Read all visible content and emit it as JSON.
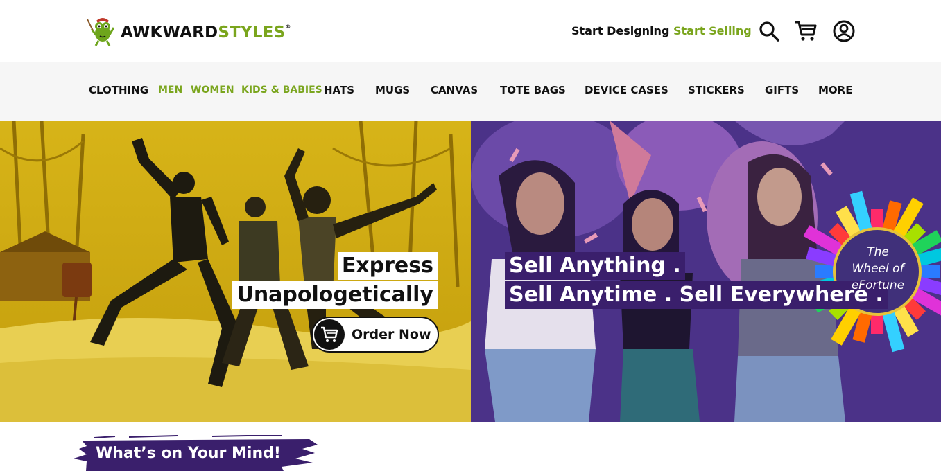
{
  "header": {
    "logo": {
      "word1": "AWKWARD",
      "word2": "STYLES",
      "reg": "®"
    },
    "links": {
      "design": "Start Designing",
      "sell": "Start Selling"
    },
    "icons": [
      "search-icon",
      "cart-icon",
      "account-icon"
    ]
  },
  "nav": {
    "items": [
      {
        "label": "CLOTHING",
        "color": "#111111"
      },
      {
        "label": "MEN",
        "color": "#7aa51d"
      },
      {
        "label": "WOMEN",
        "color": "#7aa51d"
      },
      {
        "label": "KIDS & BABIES",
        "color": "#7aa51d"
      },
      {
        "label": "HATS",
        "color": "#111111"
      },
      {
        "label": "MUGS",
        "color": "#111111"
      },
      {
        "label": "CANVAS",
        "color": "#111111"
      },
      {
        "label": "TOTE BAGS",
        "color": "#111111"
      },
      {
        "label": "DEVICE CASES",
        "color": "#111111"
      },
      {
        "label": "STICKERS",
        "color": "#111111"
      },
      {
        "label": "GIFTS",
        "color": "#111111"
      },
      {
        "label": "MORE",
        "color": "#111111"
      }
    ]
  },
  "hero": {
    "left": {
      "line1": "Express",
      "line2": "Unapologetically",
      "cta": "Order Now"
    },
    "right": {
      "line1": "Sell Anything .",
      "line2": "Sell Anytime . Sell Everywhere .",
      "wheel": {
        "l1": "The",
        "l2": "Wheel of",
        "l3": "eFortune"
      }
    }
  },
  "section": {
    "title": "What’s on Your Mind!"
  },
  "colors": {
    "brand_green": "#7aa51d",
    "brand_purple": "#3a1f6c",
    "hero_yellow": "#cda812"
  }
}
